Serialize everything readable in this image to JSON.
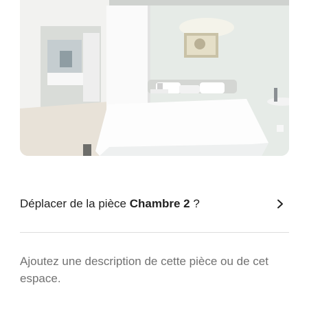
{
  "photo": {
    "icon": "bedroom-photo"
  },
  "move_row": {
    "prefix": "Déplacer de la pièce ",
    "room_name": "Chambre 2",
    "suffix": " ?",
    "icon": "chevron-right-icon"
  },
  "description": {
    "placeholder": "Ajoutez une description de cette pièce ou de cet espace."
  },
  "colors": {
    "text": "#222222",
    "muted": "#717171",
    "divider": "#dddddd"
  }
}
